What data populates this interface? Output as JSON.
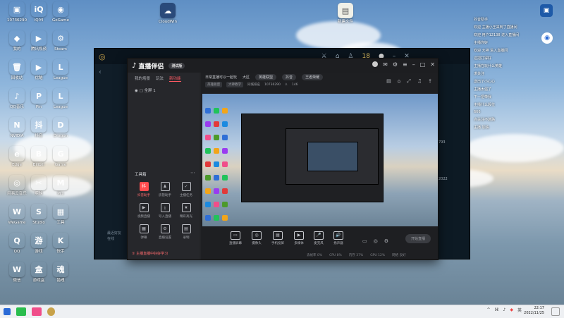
{
  "desktop": {
    "icons": [
      {
        "label": "10736290",
        "color": "#2f6fd6",
        "glyph": "▣"
      },
      {
        "label": "iQIYI",
        "color": "#20c35a",
        "glyph": "iQ"
      },
      {
        "label": "GeGame",
        "color": "#f2a51a",
        "glyph": "◉"
      },
      {
        "label": "我的",
        "color": "#2d8ae5",
        "glyph": "◆"
      },
      {
        "label": "腾讯视频",
        "color": "#1ec6a0",
        "glyph": "▶"
      },
      {
        "label": "Steam",
        "color": "#1a2b45",
        "glyph": "⚙"
      },
      {
        "label": "回收站",
        "color": "#7aa9d6",
        "glyph": "🗑"
      },
      {
        "label": "优酷",
        "color": "#9a3cf0",
        "glyph": "▶"
      },
      {
        "label": "League",
        "color": "#c8a24a",
        "glyph": "L"
      },
      {
        "label": "QQ音乐",
        "color": "#f4c21a",
        "glyph": "♪"
      },
      {
        "label": "Pin",
        "color": "#f27a2d",
        "glyph": "P"
      },
      {
        "label": "League",
        "color": "#b58b3a",
        "glyph": "L"
      },
      {
        "label": "NVIDIA",
        "color": "#4c9a2a",
        "glyph": "N"
      },
      {
        "label": "抖音",
        "color": "#f04e8a",
        "glyph": "抖"
      },
      {
        "label": "Dragon",
        "color": "#444",
        "glyph": "D"
      },
      {
        "label": "Edge",
        "color": "#1b8ae0",
        "glyph": "e"
      },
      {
        "label": "Bilibili",
        "color": "#17a9e0",
        "glyph": "B"
      },
      {
        "label": "Game",
        "color": "#555",
        "glyph": "G"
      },
      {
        "label": "网易云音乐",
        "color": "#e23a3a",
        "glyph": "◎"
      },
      {
        "label": "剪映",
        "color": "#111",
        "glyph": "✂"
      },
      {
        "label": "Mix",
        "color": "#2a7cf0",
        "glyph": "M"
      },
      {
        "label": "WeGame",
        "color": "#f0c419",
        "glyph": "W"
      },
      {
        "label": "Studio",
        "color": "#111",
        "glyph": "S"
      },
      {
        "label": "工具",
        "color": "#333",
        "glyph": "▦"
      },
      {
        "label": "QQ",
        "color": "#222",
        "glyph": "Q"
      },
      {
        "label": "游戏",
        "color": "#f28a2d",
        "glyph": "游"
      },
      {
        "label": "快手",
        "color": "#e44a3a",
        "glyph": "K"
      },
      {
        "label": "微信",
        "color": "#2bbd4e",
        "glyph": "W"
      },
      {
        "label": "游戏盒",
        "color": "#f28a2d",
        "glyph": "盒"
      },
      {
        "label": "猎魂",
        "color": "#b04a6a",
        "glyph": "魂"
      }
    ],
    "top_icons": [
      {
        "label": "CloudWin",
        "color": "#2a4a7a",
        "glyph": "☁"
      },
      {
        "label": "新建文件",
        "color": "#f0f0e8",
        "glyph": "▤"
      }
    ]
  },
  "back_window": {
    "level": "18",
    "sidebar_text": [
      "最近好友",
      "在线"
    ],
    "right_items": [
      "793",
      "2022"
    ]
  },
  "app": {
    "logo": "直播伴侣",
    "version": "测试版",
    "tabs": [
      "我的场景",
      "玩法",
      "新功能"
    ],
    "active_tab": "新功能",
    "scene": "全屏 1",
    "tools_title": "工具箱",
    "tools": [
      {
        "label": "抖音助手",
        "glyph": "抖",
        "hot": true
      },
      {
        "label": "房管助手",
        "glyph": "♟",
        "hot": false
      },
      {
        "label": "主播任务",
        "glyph": "✓",
        "hot": false
      },
      {
        "label": "视频直播",
        "glyph": "▶",
        "hot": false
      },
      {
        "label": "导入直播",
        "glyph": "⤓",
        "hot": false
      },
      {
        "label": "精彩高光",
        "glyph": "★",
        "hot": false
      },
      {
        "label": "弹幕",
        "glyph": "▦",
        "hot": false
      },
      {
        "label": "直播设置",
        "glyph": "⚙",
        "hot": false
      },
      {
        "label": "录制",
        "glyph": "▤",
        "hot": false
      }
    ],
    "notice": "① 主播直播中好好学习",
    "room": {
      "title": "日常直播可以一起玩",
      "area": "大区",
      "tags": [
        "英雄联盟",
        "抖音",
        "王者荣耀"
      ],
      "sub": [
        "英雄联盟",
        "大神教学",
        "同城排名"
      ],
      "id": "10736290",
      "viewers": "146"
    },
    "controls": [
      "直播屏幕",
      "摄像头",
      "手机投屏",
      "多媒体",
      "麦克风",
      "扬声器"
    ],
    "start_button": "开始直播",
    "status": [
      "丢帧率 0%",
      "CPU 8%",
      "内存 37%",
      "GPU 12%",
      "网络 良好"
    ]
  },
  "chat": [
    "抖音助手",
    "欢迎 主播小王来到了直播间",
    "欢迎 用户12138 进入直播间",
    "主播你好",
    "欢迎 大神 进入直播间",
    "这把打得好",
    "主播在玩什么英雄",
    "求关注",
    "送出了小心心",
    "主播太强了",
    "下一把带我",
    "主播什么段位",
    "666",
    "点关注不迷路",
    "主播 加油"
  ],
  "taskbar": {
    "time": "22:17",
    "date": "2022/11/25",
    "lang": "英"
  }
}
